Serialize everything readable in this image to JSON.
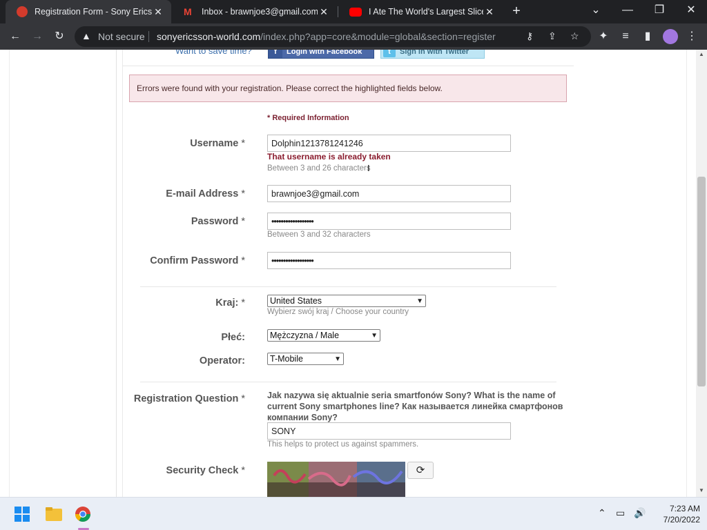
{
  "browser": {
    "tabs": [
      {
        "title": "Registration Form - Sony Ericsson",
        "active": true,
        "favicon_color": "#d33b2c"
      },
      {
        "title": "Inbox - brawnjoe3@gmail.com - ",
        "active": false,
        "favicon_color": "#ea4335"
      },
      {
        "title": "I Ate The World's Largest Slice Of",
        "active": false,
        "favicon_color": "#ff0000"
      }
    ],
    "new_tab": "+",
    "omnibox": {
      "security": "Not secure",
      "host": "sonyericsson-world.com",
      "path": "/index.php?app=core&module=global&section=register"
    }
  },
  "page": {
    "save_time_label": "Want to save time?",
    "facebook_button": "Login with Facebook",
    "twitter_button": "Sign in with Twitter",
    "error_banner": "Errors were found with your registration. Please correct the highlighted fields below.",
    "required_info": "* Required Information",
    "fields": {
      "username": {
        "label": "Username",
        "value": "Dolphin1213781241246",
        "error": "That username is already taken",
        "hint": "Between 3 and 26 characters"
      },
      "email": {
        "label": "E-mail Address",
        "value": "brawnjoe3@gmail.com"
      },
      "password": {
        "label": "Password",
        "value": "••••••••••••••••••",
        "hint": "Between 3 and 32 characters"
      },
      "confirm_password": {
        "label": "Confirm Password",
        "value": "••••••••••••••••••"
      },
      "country": {
        "label": "Kraj:",
        "value": "United States",
        "hint": "Wybierz swój kraj / Choose your country"
      },
      "gender": {
        "label": "Płeć:",
        "value": "Mężczyzna / Male"
      },
      "operator": {
        "label": "Operator:",
        "value": "T-Mobile"
      },
      "question": {
        "label": "Registration Question",
        "text": "Jak nazywa się aktualnie seria smartfonów Sony? What is the name of current Sony smartphones line? Как называется линейка смартфонов компании Sony?",
        "value": "SONY",
        "hint": "This helps to protect us against spammers."
      },
      "security": {
        "label": "Security Check"
      }
    },
    "required_star": "*"
  },
  "taskbar": {
    "time": "7:23 AM",
    "date": "7/20/2022"
  }
}
